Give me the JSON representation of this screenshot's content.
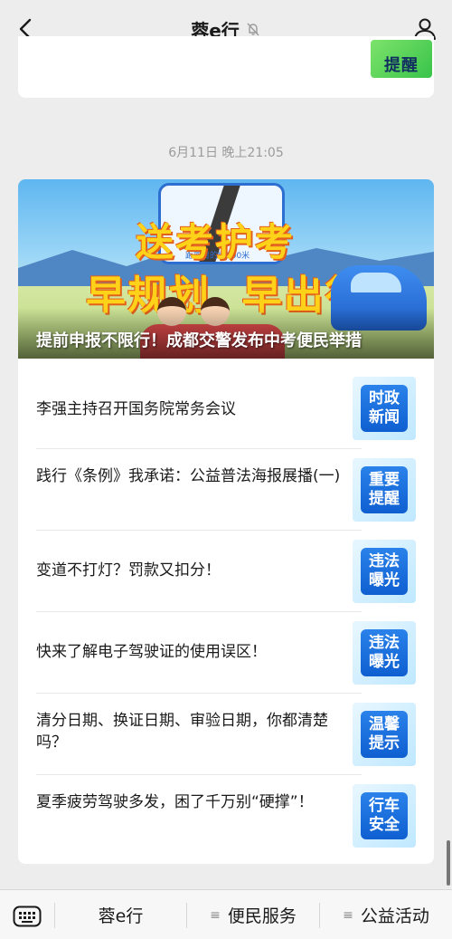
{
  "header": {
    "title": "蓉e行"
  },
  "prev_card": {
    "thumb_text": "提醒"
  },
  "timestamp": "6月11日 晚上21:05",
  "banner": {
    "slogan_line1": "送考护考",
    "slogan_line2": "早规划  早出行",
    "distance_label": "距离目的地900米",
    "caption": "提前申报不限行！成都交警发布中考便民举措"
  },
  "articles": [
    {
      "title": "李强主持召开国务院常务会议",
      "badge": "时政新闻"
    },
    {
      "title": "践行《条例》我承诺：公益普法海报展播(一)",
      "badge": "重要提醒"
    },
    {
      "title": "变道不打灯？罚款又扣分！",
      "badge": "违法曝光"
    },
    {
      "title": "快来了解电子驾驶证的使用误区！",
      "badge": "违法曝光"
    },
    {
      "title": "清分日期、换证日期、审验日期，你都清楚吗？",
      "badge": "温馨提示"
    },
    {
      "title": "夏季疲劳驾驶多发，困了千万别“硬撑”！",
      "badge": "行车安全"
    }
  ],
  "bottom_menu": {
    "item1": "蓉e行",
    "item2": "便民服务",
    "item3": "公益活动"
  },
  "colors": {
    "badge_blue": "#1a6fe0",
    "slogan_yellow": "#ffd21a",
    "background": "#ededed"
  }
}
